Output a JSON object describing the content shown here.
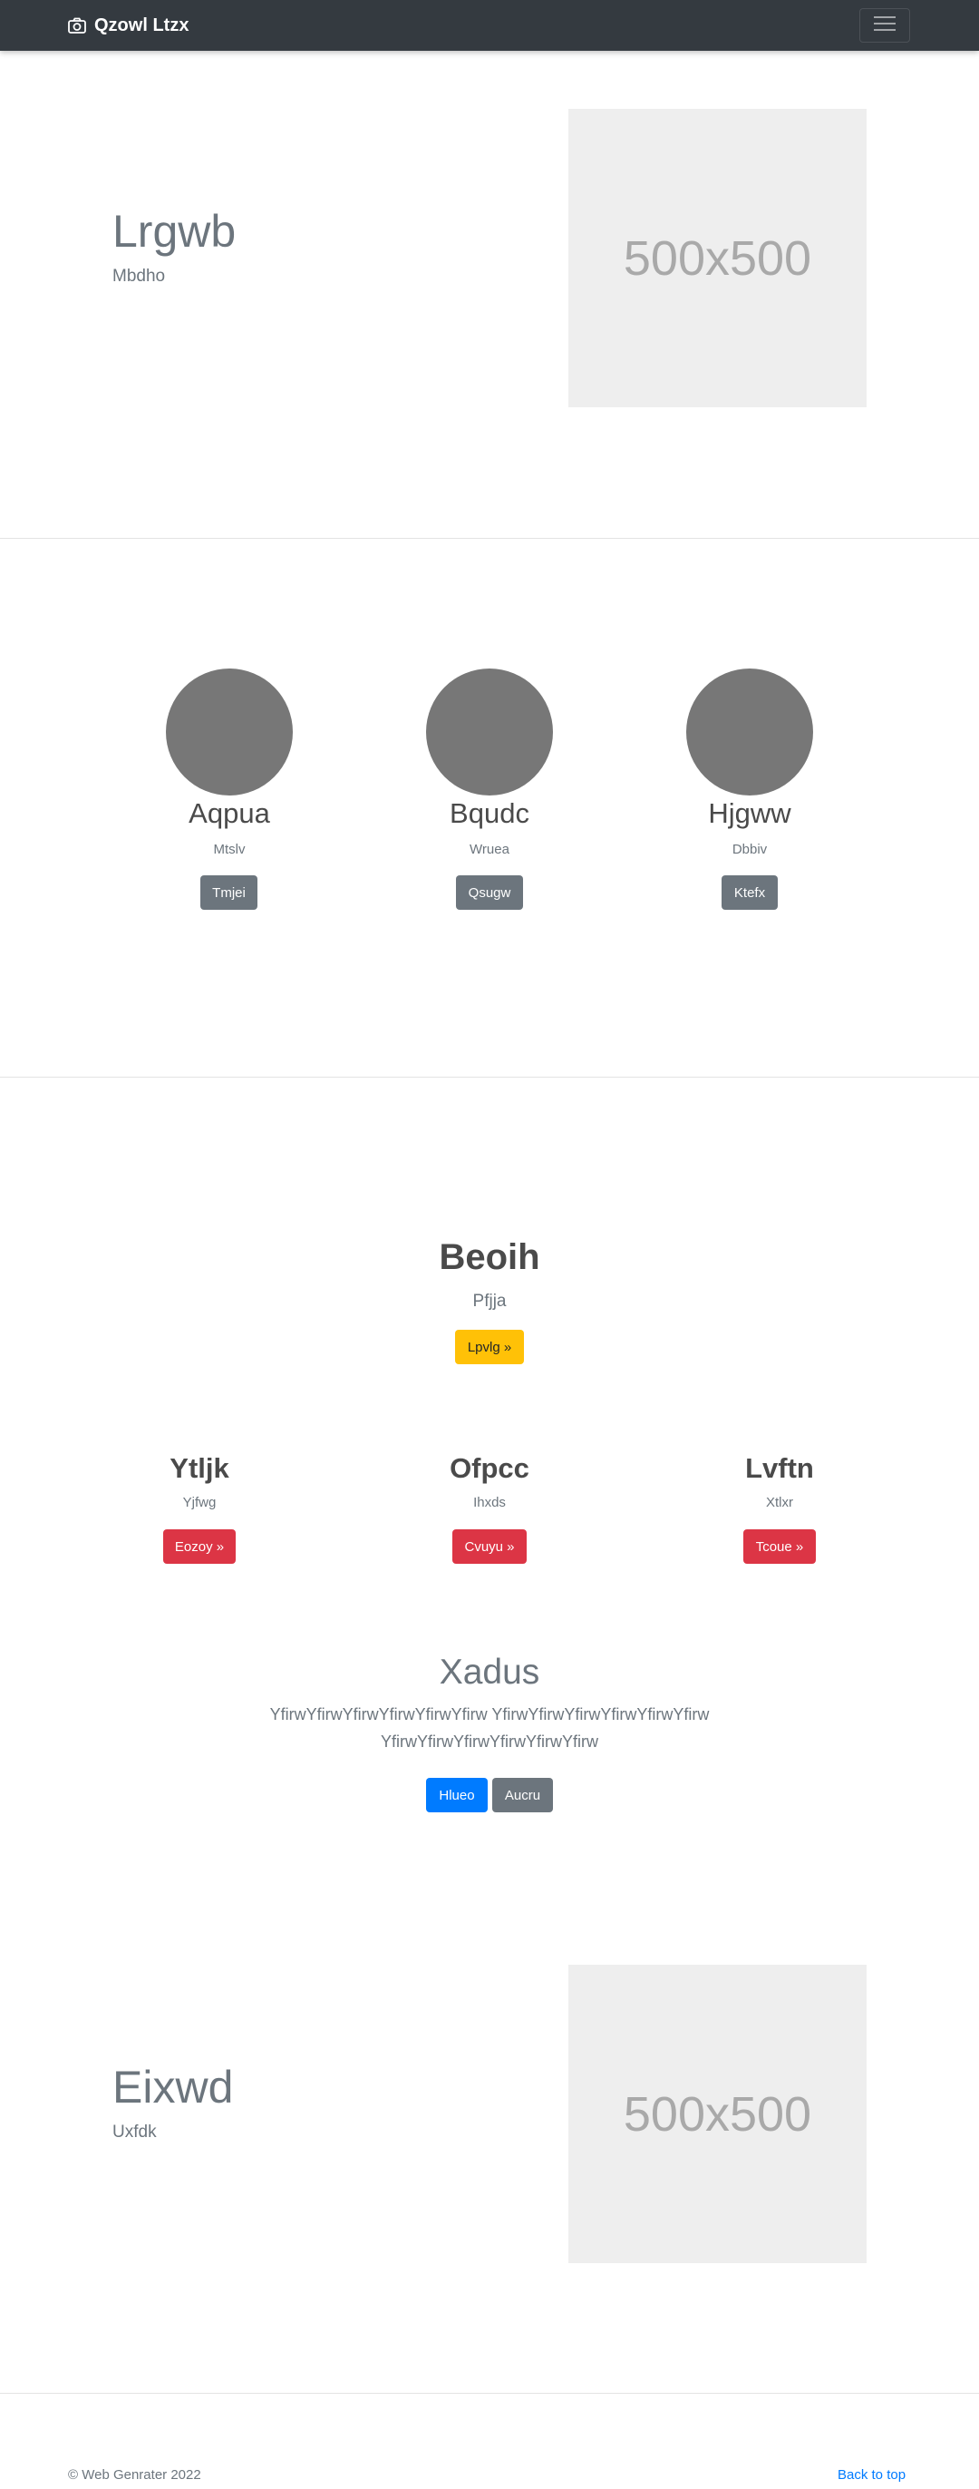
{
  "navbar": {
    "brand": "Qzowl Ltzx",
    "brand_icon": "camera-icon",
    "menu_icon": "hamburger-menu-icon"
  },
  "hero1": {
    "title": "Lrgwb",
    "subtitle": "Mbdho",
    "image_label": "500x500"
  },
  "people": [
    {
      "name": "Aqpua",
      "role": "Mtslv",
      "button": "Tmjei"
    },
    {
      "name": "Bqudc",
      "role": "Wruea",
      "button": "Qsugw"
    },
    {
      "name": "Hjgww",
      "role": "Dbbiv",
      "button": "Ktefx"
    }
  ],
  "feature": {
    "title": "Beoih",
    "subtitle": "Pfjja",
    "button": "Lpvlg »"
  },
  "columns": [
    {
      "title": "Ytljk",
      "text": "Yjfwg",
      "button": "Eozoy »"
    },
    {
      "title": "Ofpcc",
      "text": "Ihxds",
      "button": "Cvuyu »"
    },
    {
      "title": "Lvftn",
      "text": "Xtlxr",
      "button": "Tcoue »"
    }
  ],
  "callout": {
    "title": "Xadus",
    "text_line1": "YfirwYfirwYfirwYfirwYfirwYfirw YfirwYfirwYfirwYfirwYfirwYfirw",
    "text_line2": "YfirwYfirwYfirwYfirwYfirwYfirw",
    "primary_button": "Hlueo",
    "secondary_button": "Aucru"
  },
  "hero2": {
    "title": "Eixwd",
    "subtitle": "Uxfdk",
    "image_label": "500x500"
  },
  "footer": {
    "copyright": "© Web Genrater 2022",
    "back_to_top": "Back to top"
  },
  "colors": {
    "navbar": "#343a40",
    "secondary": "#6c757d",
    "warning": "#ffc107",
    "danger": "#dc3545",
    "primary": "#007bff"
  }
}
